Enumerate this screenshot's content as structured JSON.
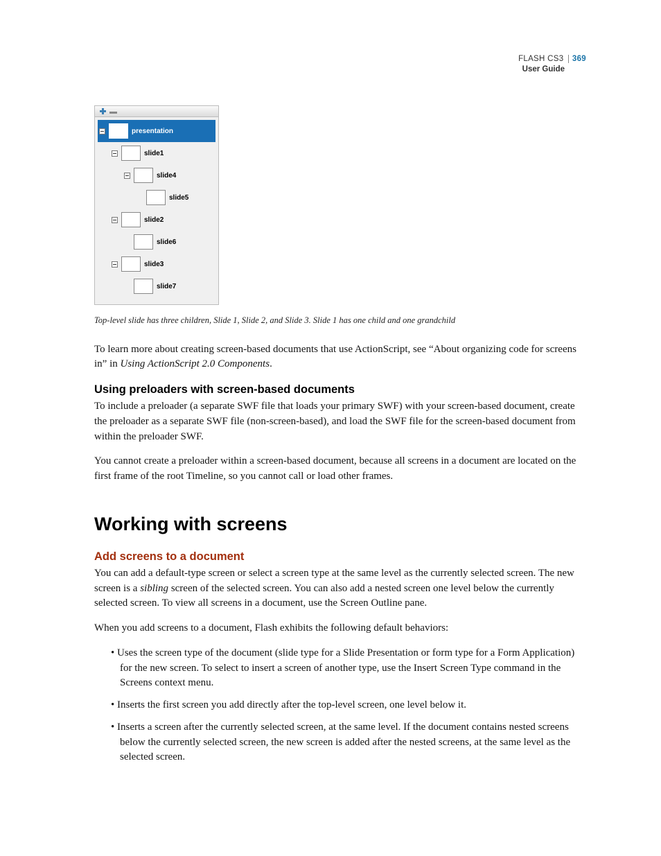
{
  "header": {
    "product": "FLASH CS3",
    "page_number": "369",
    "subtitle": "User Guide"
  },
  "panel": {
    "rows": [
      {
        "label": "presentation",
        "indent": 0,
        "toggle": "minus",
        "selected": true
      },
      {
        "label": "slide1",
        "indent": 1,
        "toggle": "minus",
        "selected": false
      },
      {
        "label": "slide4",
        "indent": 2,
        "toggle": "minus",
        "selected": false
      },
      {
        "label": "slide5",
        "indent": 3,
        "toggle": "none",
        "selected": false
      },
      {
        "label": "slide2",
        "indent": 1,
        "toggle": "minus",
        "selected": false
      },
      {
        "label": "slide6",
        "indent": 2,
        "toggle": "none",
        "selected": false
      },
      {
        "label": "slide3",
        "indent": 1,
        "toggle": "minus",
        "selected": false
      },
      {
        "label": "slide7",
        "indent": 2,
        "toggle": "none",
        "selected": false
      }
    ]
  },
  "caption": "Top-level slide has three children, Slide 1, Slide 2, and Slide 3. Slide 1 has one child and one grandchild",
  "para1a": "To learn more about creating screen-based documents that use ActionScript, see “About organizing code for screens in” in ",
  "para1b": "Using ActionScript 2.0 Components",
  "para1c": ".",
  "h_preloaders": "Using preloaders with screen-based documents",
  "para2": "To include a preloader (a separate SWF file that loads your primary SWF) with your screen-based document, create the preloader as a separate SWF file (non-screen-based), and load the SWF file for the screen-based document from within the preloader SWF.",
  "para3": "You cannot create a preloader within a screen-based document, because all screens in a document are located on the first frame of the root Timeline, so you cannot call or load other frames.",
  "h_working": "Working with screens",
  "h_add": "Add screens to a document",
  "para4a": "You can add a default-type screen or select a screen type at the same level as the currently selected screen. The new screen is a ",
  "para4b": "sibling",
  "para4c": " screen of the selected screen. You can also add a nested screen one level below the currently selected screen. To view all screens in a document, use the Screen Outline pane.",
  "para5": "When you add screens to a document, Flash exhibits the following default behaviors:",
  "bullets": {
    "b1": "Uses the screen type of the document (slide type for a Slide Presentation or form type for a Form Application) for the new screen. To select to insert a screen of another type, use the Insert Screen Type command in the Screens context menu.",
    "b2": "Inserts the first screen you add directly after the top-level screen, one level below it.",
    "b3": "Inserts a screen after the currently selected screen, at the same level. If the document contains nested screens below the currently selected screen, the new screen is added after the nested screens, at the same level as the selected screen."
  }
}
